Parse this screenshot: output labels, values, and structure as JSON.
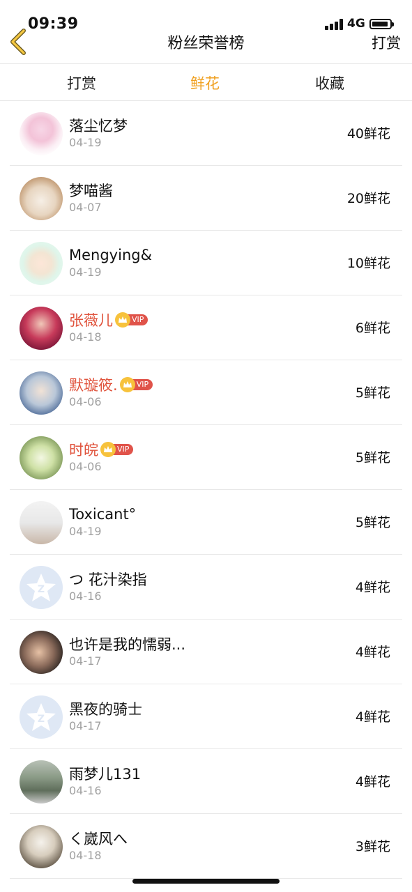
{
  "status": {
    "time": "09:39",
    "network": "4G"
  },
  "nav": {
    "title": "粉丝荣誉榜",
    "right_label": "打赏"
  },
  "tabs": [
    {
      "label": "打赏",
      "active": false
    },
    {
      "label": "鲜花",
      "active": true
    },
    {
      "label": "收藏",
      "active": false
    }
  ],
  "colors": {
    "accent": "#f0a020",
    "vip_name": "#e0533c",
    "vip_badge": "#e0534a",
    "date": "#a0a0a0"
  },
  "vip_label": "VIP",
  "fans": [
    {
      "name": "落尘忆梦",
      "date": "04-19",
      "count": "40鲜花",
      "vip": false,
      "avatar": "anime-girl"
    },
    {
      "name": "梦喵酱",
      "date": "04-07",
      "count": "20鲜花",
      "vip": false,
      "avatar": "cat"
    },
    {
      "name": "Mengying&",
      "date": "04-19",
      "count": "10鲜花",
      "vip": false,
      "avatar": "anime-boy"
    },
    {
      "name": "张薇儿",
      "date": "04-18",
      "count": "6鲜花",
      "vip": true,
      "avatar": "woman-red"
    },
    {
      "name": "默璇筱.",
      "date": "04-06",
      "count": "5鲜花",
      "vip": true,
      "avatar": "girl-portrait"
    },
    {
      "name": "时皖",
      "date": "04-06",
      "count": "5鲜花",
      "vip": true,
      "avatar": "green-drink"
    },
    {
      "name": "Toxicant°",
      "date": "04-19",
      "count": "5鲜花",
      "vip": false,
      "avatar": "white-dogs"
    },
    {
      "name": "つ 花汁染指",
      "date": "04-16",
      "count": "4鲜花",
      "vip": false,
      "avatar": "qq-default"
    },
    {
      "name": "也许是我的懦弱...",
      "date": "04-17",
      "count": "4鲜花",
      "vip": false,
      "avatar": "couple"
    },
    {
      "name": "黑夜的骑士",
      "date": "04-17",
      "count": "4鲜花",
      "vip": false,
      "avatar": "qq-default"
    },
    {
      "name": "雨梦儿131",
      "date": "04-16",
      "count": "4鲜花",
      "vip": false,
      "avatar": "park"
    },
    {
      "name": "く崴风へ",
      "date": "04-18",
      "count": "3鲜花",
      "vip": false,
      "avatar": "fox-figure"
    }
  ]
}
